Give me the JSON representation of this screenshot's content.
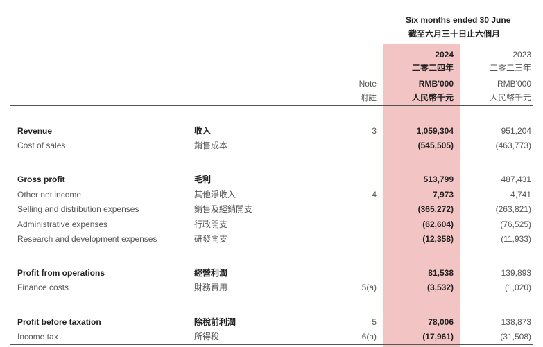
{
  "header": {
    "period_en": "Six months ended 30 June",
    "period_zh": "截至六月三十日止六個月",
    "note_en": "Note",
    "note_zh": "附註",
    "y2024": "2024",
    "y2024_zh": "二零二四年",
    "y2023": "2023",
    "y2023_zh": "二零二三年",
    "unit_en": "RMB'000",
    "unit_zh": "人民幣千元"
  },
  "rows": [
    {
      "en": "Revenue",
      "zh": "收入",
      "note": "3",
      "v2024": "1,059,304",
      "v2023": "951,204",
      "bold": true
    },
    {
      "en": "Cost of sales",
      "zh": "銷售成本",
      "note": "",
      "v2024": "(545,505)",
      "v2023": "(463,773)",
      "bold": false
    },
    {
      "en": "Gross profit",
      "zh": "毛利",
      "note": "",
      "v2024": "513,799",
      "v2023": "487,431",
      "bold": true
    },
    {
      "en": "Other net income",
      "zh": "其他淨收入",
      "note": "4",
      "v2024": "7,973",
      "v2023": "4,741",
      "bold": false
    },
    {
      "en": "Selling and distribution expenses",
      "zh": "銷售及經銷開支",
      "note": "",
      "v2024": "(365,272)",
      "v2023": "(263,821)",
      "bold": false
    },
    {
      "en": "Administrative expenses",
      "zh": "行政開支",
      "note": "",
      "v2024": "(62,604)",
      "v2023": "(76,525)",
      "bold": false
    },
    {
      "en": "Research and development expenses",
      "zh": "研發開支",
      "note": "",
      "v2024": "(12,358)",
      "v2023": "(11,933)",
      "bold": false
    },
    {
      "en": "Profit from operations",
      "zh": "經營利潤",
      "note": "",
      "v2024": "81,538",
      "v2023": "139,893",
      "bold": true
    },
    {
      "en": "Finance costs",
      "zh": "財務費用",
      "note": "5(a)",
      "v2024": "(3,532)",
      "v2023": "(1,020)",
      "bold": false
    },
    {
      "en": "Profit before taxation",
      "zh": "除稅前利潤",
      "note": "5",
      "v2024": "78,006",
      "v2023": "138,873",
      "bold": true
    },
    {
      "en": "Income tax",
      "zh": "所得稅",
      "note": "6(a)",
      "v2024": "(17,961)",
      "v2023": "(31,508)",
      "bold": false
    }
  ]
}
